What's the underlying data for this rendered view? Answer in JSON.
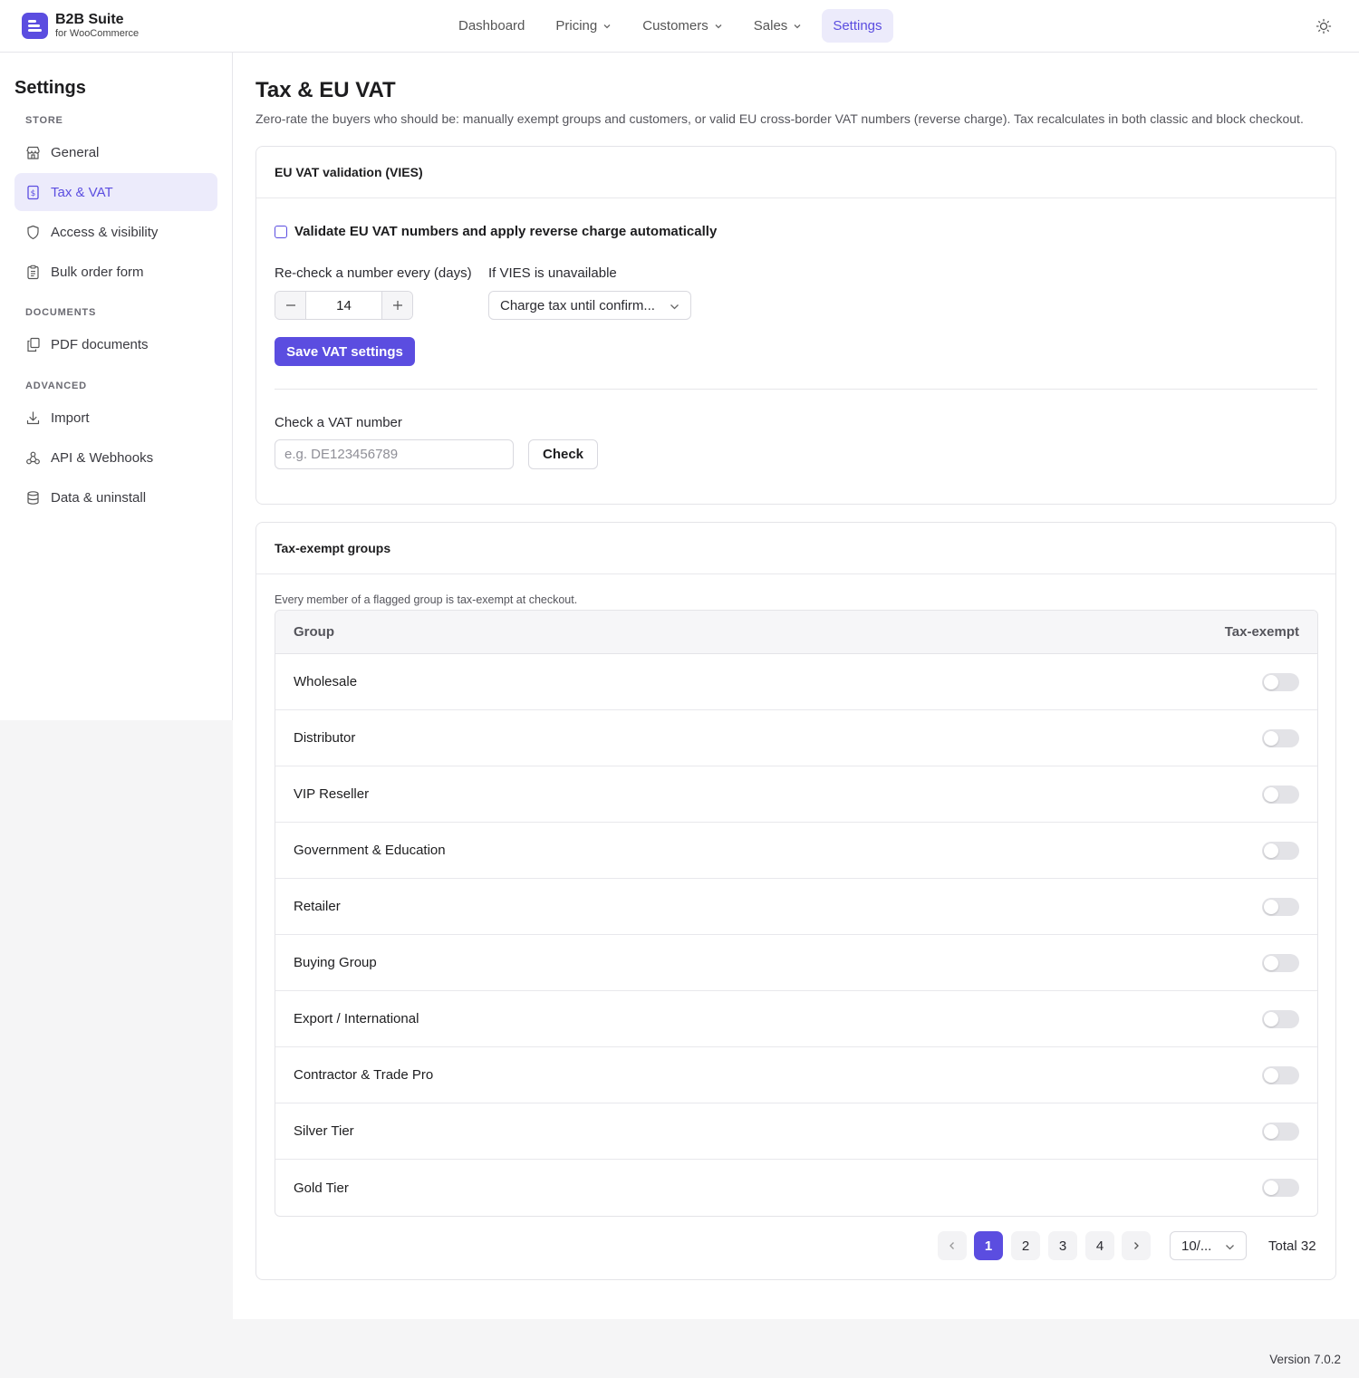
{
  "brand": {
    "name": "B2B Suite",
    "subtitle": "for WooCommerce"
  },
  "nav": {
    "dashboard": "Dashboard",
    "pricing": "Pricing",
    "customers": "Customers",
    "sales": "Sales",
    "settings": "Settings"
  },
  "sidebar": {
    "title": "Settings",
    "sections": {
      "store": "STORE",
      "documents": "DOCUMENTS",
      "advanced": "ADVANCED"
    },
    "items": {
      "general": "General",
      "tax_vat": "Tax & VAT",
      "access": "Access & visibility",
      "bulk_order": "Bulk order form",
      "pdf": "PDF documents",
      "import": "Import",
      "api": "API & Webhooks",
      "data": "Data & uninstall"
    }
  },
  "page": {
    "title": "Tax & EU VAT",
    "description": "Zero-rate the buyers who should be: manually exempt groups and customers, or valid EU cross-border VAT numbers (reverse charge). Tax recalculates in both classic and block checkout."
  },
  "vat_card": {
    "title": "EU VAT validation (VIES)",
    "validate_label": "Validate EU VAT numbers and apply reverse charge automatically",
    "validate_checked": false,
    "recheck_label": "Re-check a number every (days)",
    "recheck_value": "14",
    "unavailable_label": "If VIES is unavailable",
    "unavailable_value": "Charge tax until confirm...",
    "save_label": "Save VAT settings",
    "check_label": "Check a VAT number",
    "check_placeholder": "e.g. DE123456789",
    "check_button": "Check"
  },
  "groups_card": {
    "title": "Tax-exempt groups",
    "note": "Every member of a flagged group is tax-exempt at checkout.",
    "col_group": "Group",
    "col_exempt": "Tax-exempt",
    "rows": [
      {
        "name": "Wholesale",
        "exempt": false
      },
      {
        "name": "Distributor",
        "exempt": false
      },
      {
        "name": "VIP Reseller",
        "exempt": false
      },
      {
        "name": "Government & Education",
        "exempt": false
      },
      {
        "name": "Retailer",
        "exempt": false
      },
      {
        "name": "Buying Group",
        "exempt": false
      },
      {
        "name": "Export / International",
        "exempt": false
      },
      {
        "name": "Contractor & Trade Pro",
        "exempt": false
      },
      {
        "name": "Silver Tier",
        "exempt": false
      },
      {
        "name": "Gold Tier",
        "exempt": false
      }
    ]
  },
  "pagination": {
    "pages": [
      "1",
      "2",
      "3",
      "4"
    ],
    "current": "1",
    "page_size": "10/...",
    "total": "Total 32"
  },
  "footer": {
    "version": "Version 7.0.2"
  },
  "colors": {
    "accent": "#5b4de0",
    "accent_bg": "#ecebfb"
  }
}
